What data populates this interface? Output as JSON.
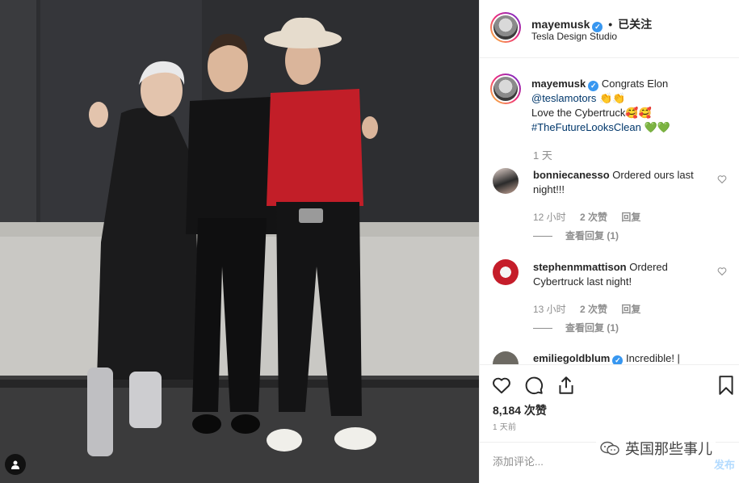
{
  "post": {
    "user": "mayemusk",
    "follow_state": "已关注",
    "location": "Tesla Design Studio",
    "dot": "•"
  },
  "caption": {
    "user": "mayemusk",
    "line1": "Congrats Elon",
    "line2_link": "@teslamotors",
    "line2_emoji": "👏👏",
    "line3": "Love the Cybertruck🥰🥰",
    "line4_tag": "#TheFutureLooksClean",
    "line4_emoji": "💚💚",
    "time": "1 天"
  },
  "comments": [
    {
      "user": "bonniecanesso",
      "text": "Ordered ours last night!!!",
      "time": "12 小时",
      "likes": "2 次赞",
      "reply": "回复",
      "view_replies": "查看回复 (1)"
    },
    {
      "user": "stephenmmattison",
      "text": "Ordered Cybertruck last night!",
      "time": "13 小时",
      "likes": "2 次赞",
      "reply": "回复",
      "view_replies": "查看回复 (1)"
    },
    {
      "user": "emiliegoldblum",
      "text": "Incredible! |"
    }
  ],
  "footer": {
    "likes": "8,184 次赞",
    "posted": "1 天前",
    "comment_placeholder": "添加评论...",
    "post_button": "发布"
  },
  "watermark": {
    "text": "英国那些事儿"
  },
  "icons": {
    "like": "heart-icon",
    "comment": "comment-icon",
    "share": "share-icon",
    "save": "bookmark-icon",
    "verified": "verified-badge-icon",
    "tag": "user-tag-icon"
  },
  "colors": {
    "verified": "#3897f0",
    "link": "#00376b",
    "muted": "#8e8e8e",
    "post_button": "#b3dbff"
  }
}
